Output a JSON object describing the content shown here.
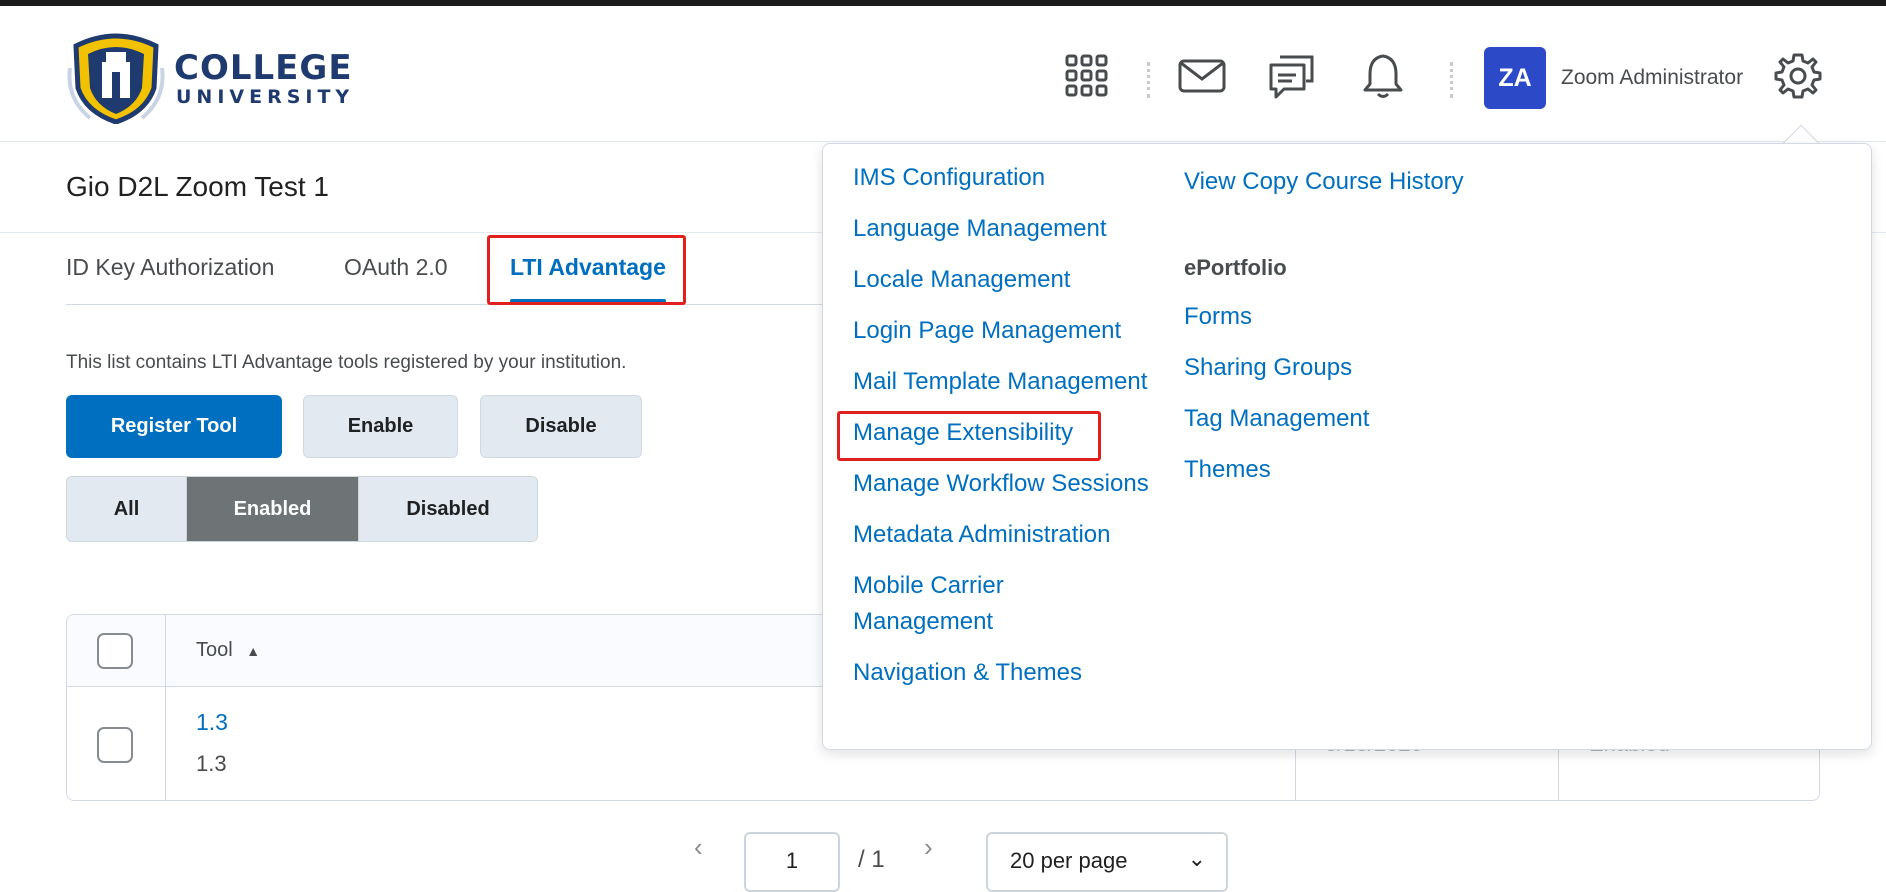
{
  "header": {
    "logo_line1": "COLLEGE",
    "logo_line2": "UNIVERSITY",
    "avatar_initials": "ZA",
    "user_name": "Zoom Administrator"
  },
  "course": {
    "title": "Gio D2L Zoom Test 1"
  },
  "tabs": [
    "ID Key Authorization",
    "OAuth 2.0",
    "LTI Advantage"
  ],
  "description": "This list contains LTI Advantage tools registered by your institution.",
  "buttons": {
    "register": "Register Tool",
    "enable": "Enable",
    "disable": "Disable"
  },
  "filters": [
    "All",
    "Enabled",
    "Disabled"
  ],
  "table": {
    "header_tool": "Tool",
    "row": {
      "link": "1.3",
      "sub": "1.3",
      "date_partial": "8/18/2020",
      "status_partial": "Enabled"
    }
  },
  "pager": {
    "page": "1",
    "of": "/ 1",
    "page_size": "20 per page"
  },
  "menu": {
    "col1": [
      "IMS Configuration",
      "Language Management",
      "Locale Management",
      "Login Page Management",
      "Mail Template Management",
      "Manage Extensibility",
      "Manage Workflow Sessions",
      "Metadata Administration",
      "Mobile Carrier",
      "Management",
      "Navigation & Themes"
    ],
    "col2_top": "View Copy Course History",
    "col2_heading": "ePortfolio",
    "col2": [
      "Forms",
      "Sharing Groups",
      "Tag Management",
      "Themes"
    ]
  },
  "colors": {
    "primary": "#006fbf",
    "highlight": "#e0201c",
    "avatar": "#2c49c7"
  }
}
